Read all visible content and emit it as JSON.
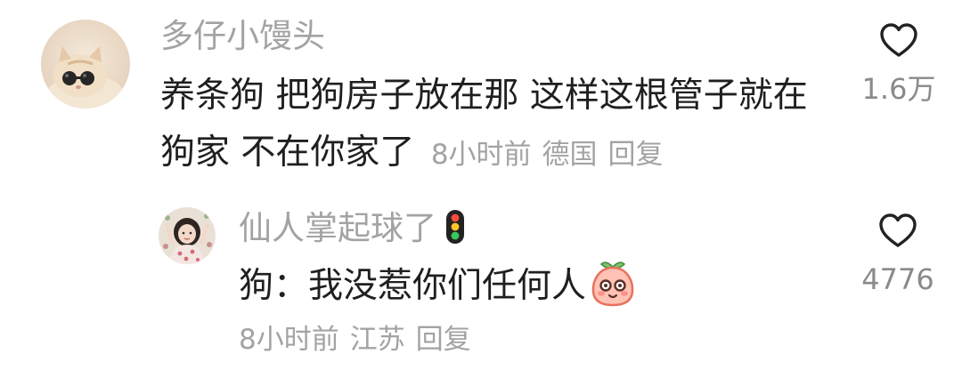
{
  "comment": {
    "username": "多仔小馒头",
    "avatar_icon": "cat-with-sunglasses-avatar",
    "text": "养条狗 把狗房子放在那 这样这根管子就在狗家 不在你家了",
    "time": "8小时前",
    "location": "德国",
    "reply_label": "回复",
    "like_icon": "heart-outline-icon",
    "like_count": "1.6万"
  },
  "reply": {
    "username": "仙人掌起球了",
    "username_badge_icon": "traffic-light-icon",
    "avatar_icon": "girl-avatar",
    "text": "狗：我没惹你们任何人",
    "trailing_emoji_icon": "peach-face-emoji",
    "time": "8小时前",
    "location": "江苏",
    "reply_label": "回复",
    "like_icon": "heart-outline-icon",
    "like_count": "4776"
  },
  "colors": {
    "secondary_text": "#a3a3a3",
    "primary_text": "#1f1f1f",
    "like_count": "#8a8a8a"
  }
}
